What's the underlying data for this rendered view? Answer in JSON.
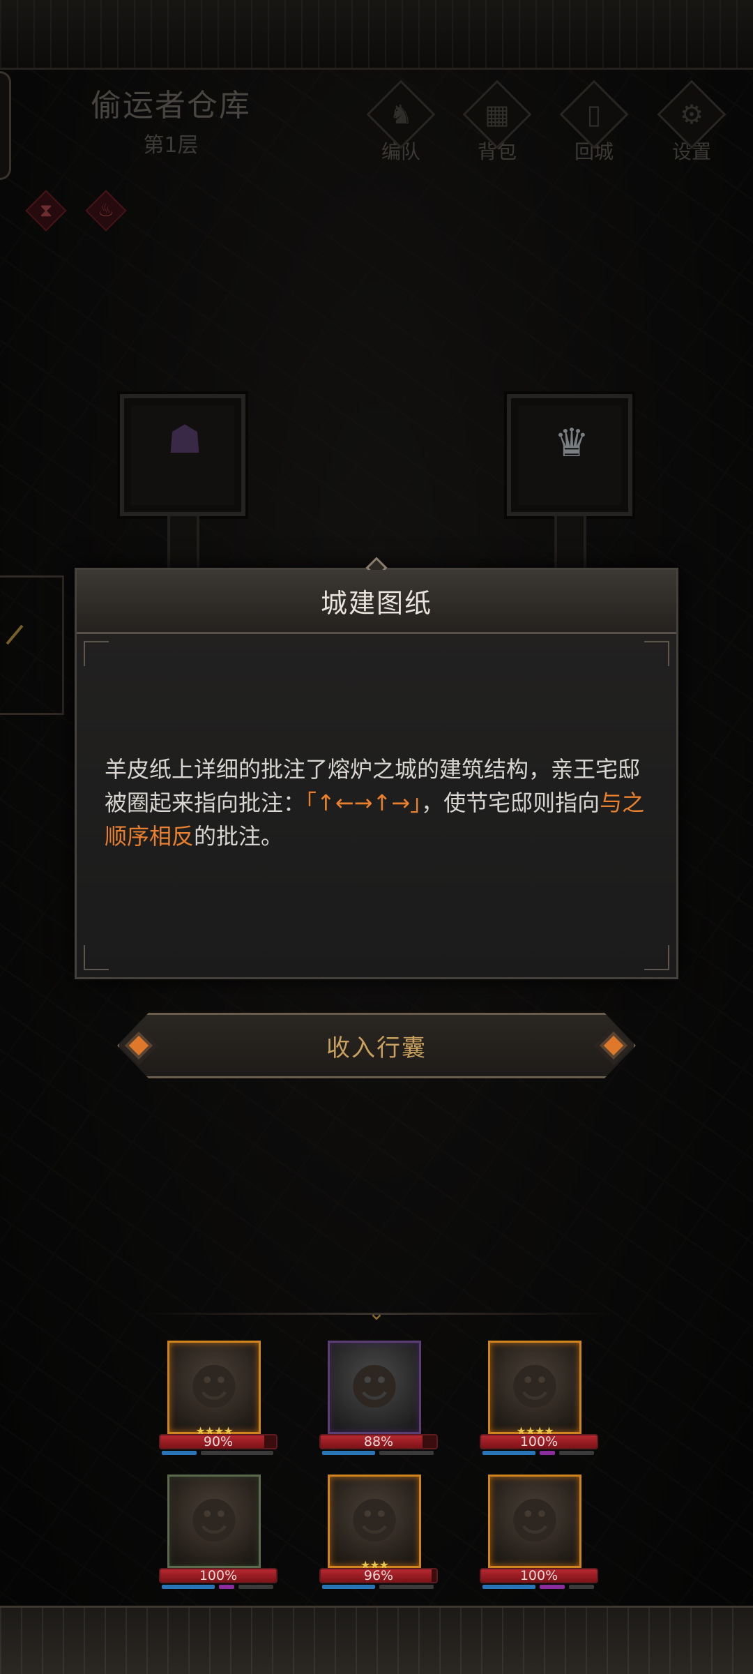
{
  "location": {
    "name": "偷运者仓库",
    "floor": "第1层"
  },
  "nav": [
    {
      "label": "编队",
      "icon": "horned-helmet-icon"
    },
    {
      "label": "背包",
      "icon": "backpack-icon"
    },
    {
      "label": "回城",
      "icon": "exit-door-icon"
    },
    {
      "label": "设置",
      "icon": "gear-icon"
    }
  ],
  "status_effects": [
    {
      "icon": "hourglass-icon"
    },
    {
      "icon": "flame-icon"
    }
  ],
  "dialog": {
    "title": "城建图纸",
    "text_before": "羊皮纸上详细的批注了熔炉之城的建筑结构，亲王宅邸被圈起来指向批注：",
    "sequence": "「↑←→↑→」",
    "text_middle": "，使节宅邸则指向",
    "emphasis": "与之顺序相反",
    "text_after": "的批注。"
  },
  "collect_button": {
    "label": "收入行囊"
  },
  "party": [
    {
      "hp_label": "90%",
      "hp": 0.9,
      "stars": "★★★★",
      "frame": "orange"
    },
    {
      "hp_label": "88%",
      "hp": 0.88,
      "stars": "",
      "frame": "purple"
    },
    {
      "hp_label": "100%",
      "hp": 1.0,
      "stars": "★★★★",
      "frame": "orange"
    },
    {
      "hp_label": "100%",
      "hp": 1.0,
      "stars": "",
      "frame": "green"
    },
    {
      "hp_label": "96%",
      "hp": 0.96,
      "stars": "★★★",
      "frame": "orange"
    },
    {
      "hp_label": "100%",
      "hp": 1.0,
      "stars": "",
      "frame": "orange"
    }
  ],
  "colors": {
    "accent": "#e8802f",
    "hp": "#b5282f",
    "mana": "#2a74b8",
    "gold": "#c9a15f"
  }
}
